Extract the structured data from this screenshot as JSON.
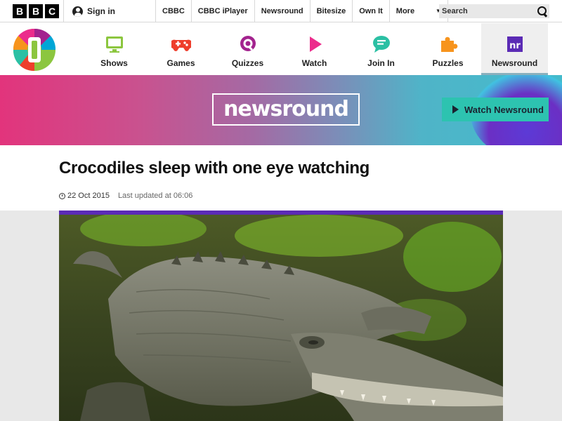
{
  "bbc_bar": {
    "logo_letters": [
      "B",
      "B",
      "C"
    ],
    "sign_in": "Sign in",
    "nav_items": [
      "CBBC",
      "CBBC iPlayer",
      "Newsround",
      "Bitesize",
      "Own It"
    ],
    "more": "More",
    "search_placeholder": "Search"
  },
  "cbbc_nav": {
    "items": [
      {
        "label": "Shows",
        "icon": "tv-icon",
        "color": "#8cc63f"
      },
      {
        "label": "Games",
        "icon": "gamepad-icon",
        "color": "#ee3e2c"
      },
      {
        "label": "Quizzes",
        "icon": "quiz-icon",
        "color": "#a3238e"
      },
      {
        "label": "Watch",
        "icon": "play-icon",
        "color": "#ec2c8c"
      },
      {
        "label": "Join In",
        "icon": "chat-icon",
        "color": "#2bc0a4"
      },
      {
        "label": "Puzzles",
        "icon": "puzzle-icon",
        "color": "#f7941d"
      },
      {
        "label": "Newsround",
        "icon": "newsround-icon",
        "color": "#5b2bb5"
      }
    ],
    "active": "Newsround"
  },
  "banner": {
    "logo_text": "newsround",
    "watch_button": "Watch Newsround"
  },
  "article": {
    "title": "Crocodiles sleep with one eye watching",
    "date": "22 Oct 2015",
    "updated": "Last updated at 06:06"
  }
}
